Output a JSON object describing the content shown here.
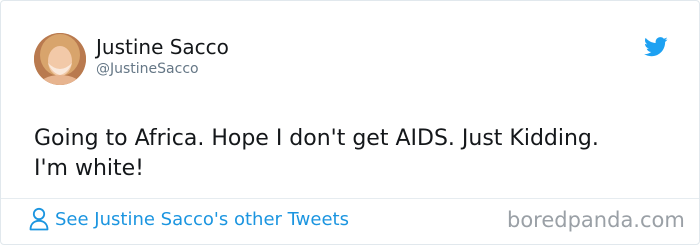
{
  "author": {
    "name": "Justine Sacco",
    "handle": "@JustineSacco"
  },
  "tweet": {
    "line1": "Going to Africa. Hope I don't get AIDS. Just Kidding.",
    "line2": "I'm white!"
  },
  "footer": {
    "link_text": "See Justine Sacco's other Tweets"
  },
  "watermark": "boredpanda.com",
  "icons": {
    "brand": "twitter-bird-icon",
    "footer": "person-outline-icon"
  },
  "colors": {
    "accent": "#1da1f2",
    "link": "#1b95e0",
    "text": "#14171a",
    "muted": "#657786"
  }
}
